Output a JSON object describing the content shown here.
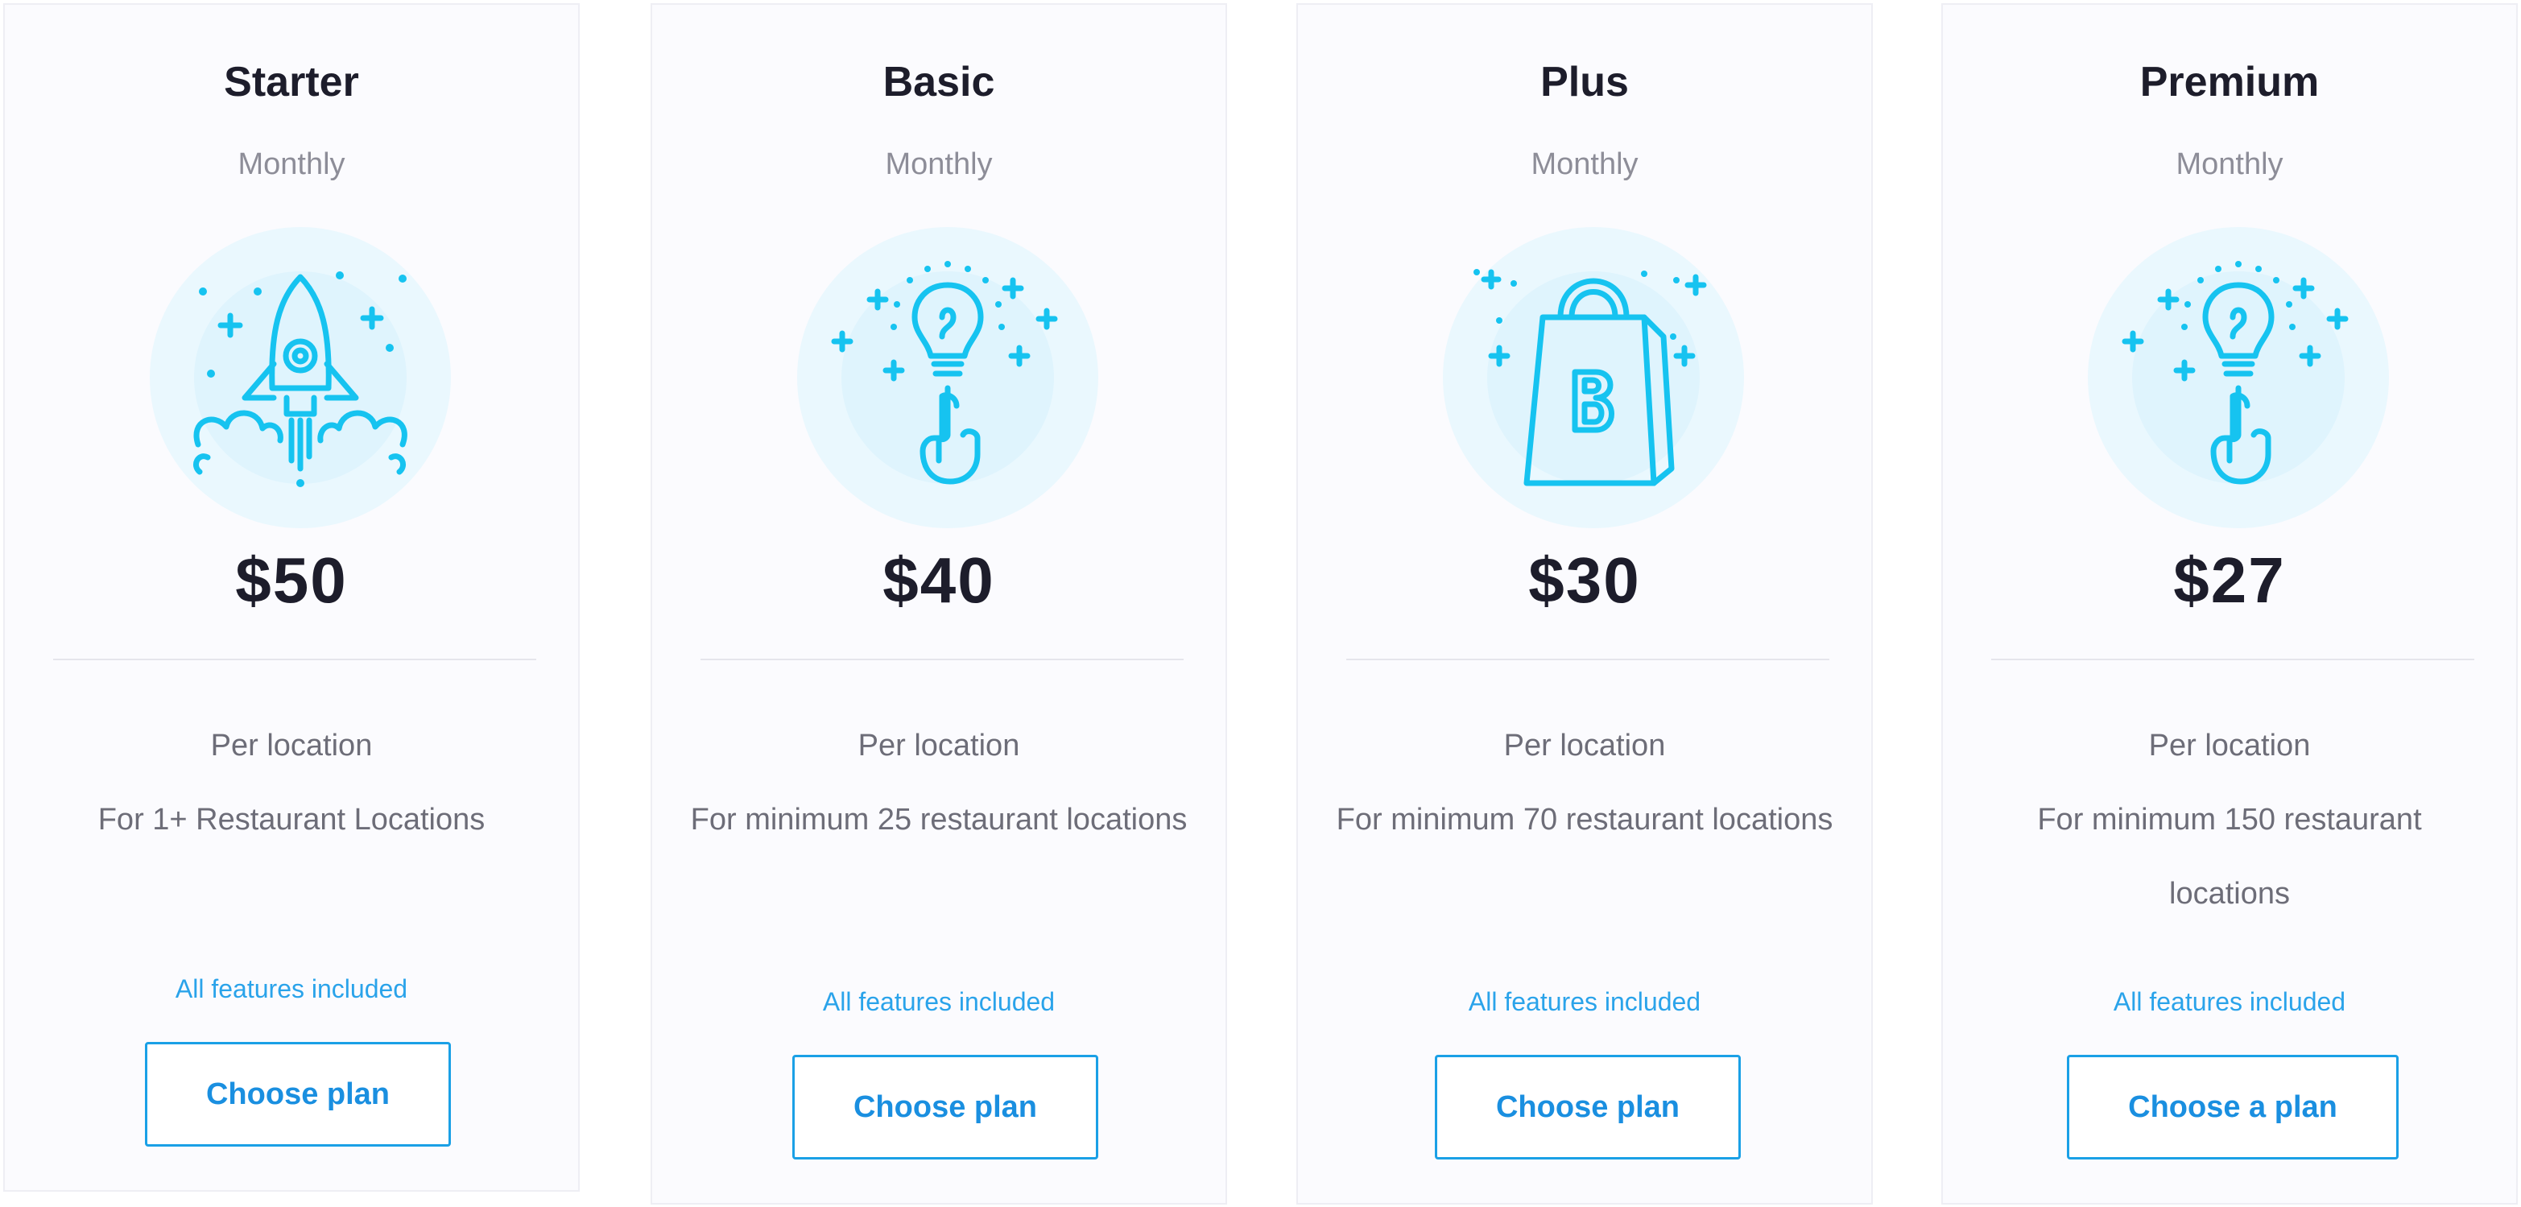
{
  "plans": [
    {
      "name": "Starter",
      "period": "Monthly",
      "icon": "rocket-icon",
      "price": "$50",
      "unit": "Per location",
      "description": "For 1+ Restaurant Locations",
      "features": "All features included",
      "button_label": "Choose plan"
    },
    {
      "name": "Basic",
      "period": "Monthly",
      "icon": "lightbulb-idea-icon",
      "price": "$40",
      "unit": "Per location",
      "description": "For minimum 25 restaurant locations",
      "features": "All features included",
      "button_label": "Choose plan"
    },
    {
      "name": "Plus",
      "period": "Monthly",
      "icon": "shopping-bag-icon",
      "price": "$30",
      "unit": "Per location",
      "description": "For minimum 70 restaurant locations",
      "features": "All features included",
      "button_label": "Choose plan"
    },
    {
      "name": "Premium",
      "period": "Monthly",
      "icon": "lightbulb-idea-icon",
      "price": "$27",
      "unit": "Per location",
      "description": "For minimum 150 restaurant locations",
      "features": "All features included",
      "button_label": "Choose a plan"
    }
  ],
  "colors": {
    "accent": "#1aa0e6",
    "icon": "#16c3f0",
    "icon_bg_outer": "#eaf8fe",
    "icon_bg_inner": "#dff4fd",
    "text_dark": "#1d1d2b",
    "text_muted": "#8d8d98",
    "card_bg": "#fbfbfe",
    "card_border": "#eeeef4"
  }
}
